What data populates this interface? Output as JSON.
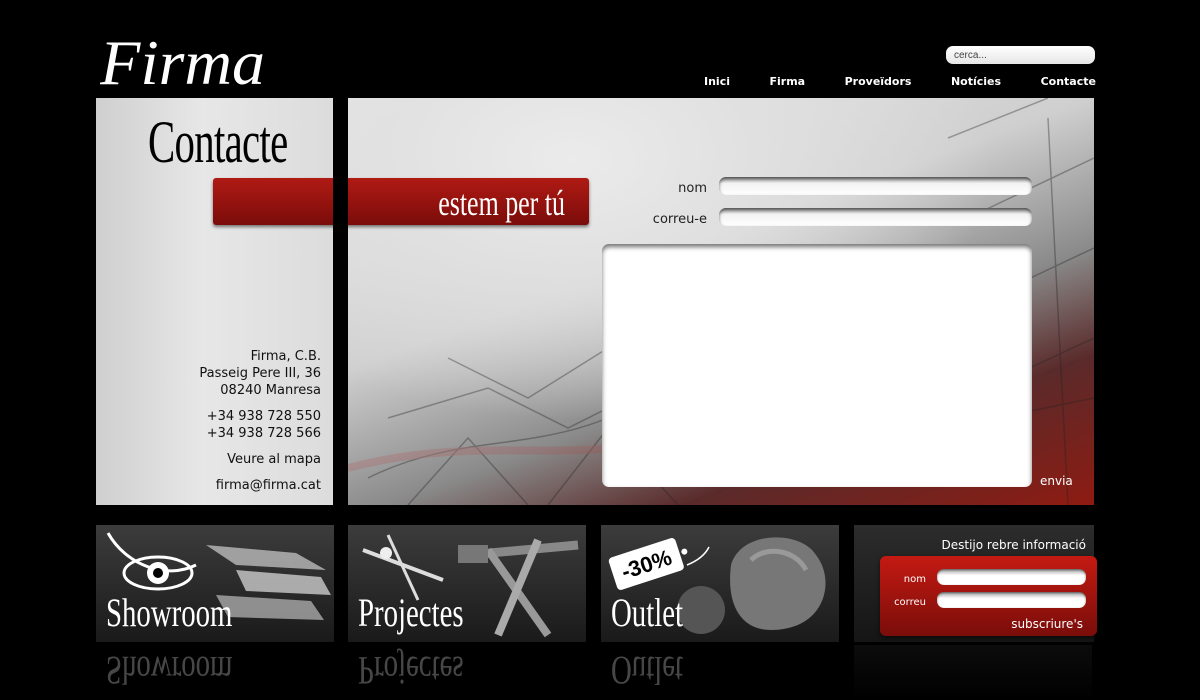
{
  "header": {
    "logo_text": "Firma",
    "search_placeholder": "cerca...",
    "nav": [
      "Inici",
      "Firma",
      "Proveïdors",
      "Notícies",
      "Contacte"
    ]
  },
  "sidebar": {
    "page_title": "Contacte",
    "company": "Firma, C.B.",
    "street": "Passeig Pere III, 36",
    "city": "08240 Manresa",
    "phone1": "+34 938 728 550",
    "phone2": "+34 938 728 566",
    "map_link": "Veure al mapa",
    "email": "firma@firma.cat"
  },
  "banner": {
    "tagline": "estem per tú"
  },
  "contact_form": {
    "name_label": "nom",
    "email_label": "correu-e",
    "send_label": "envia"
  },
  "tiles": {
    "showroom": "Showroom",
    "projectes": "Projectes",
    "outlet": "Outlet",
    "outlet_tag": "-30%"
  },
  "subscribe": {
    "heading": "Destijo rebre informació",
    "name_label": "nom",
    "email_label": "correu",
    "button": "subscriure's"
  },
  "colors": {
    "accent_red": "#a8150f",
    "background": "#000000"
  }
}
